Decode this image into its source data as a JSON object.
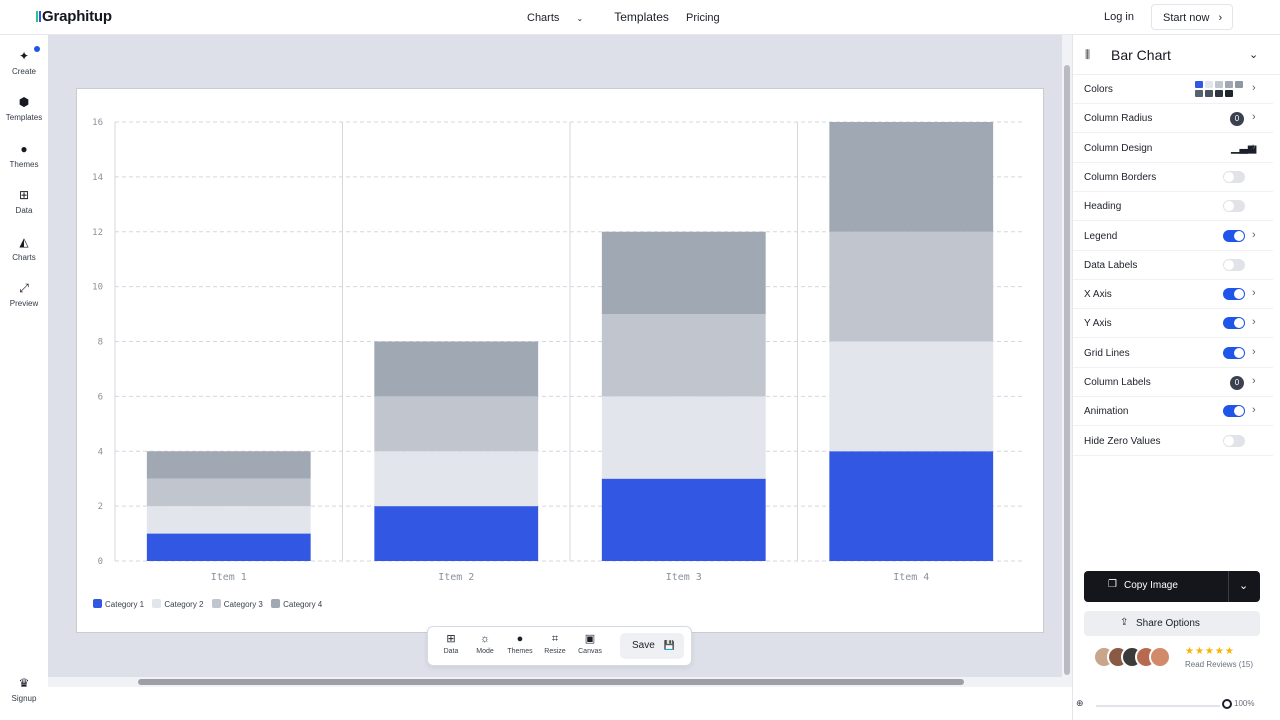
{
  "header": {
    "logo": "Graphitup",
    "nav": [
      "Charts",
      "Templates",
      "Pricing"
    ],
    "nav_charts_chevron": "⌄",
    "login": "Log in",
    "start": "Start now",
    "start_chevron": "›"
  },
  "rail": {
    "items": [
      {
        "label": "Create",
        "icon": "sparkle-icon",
        "glyph": "✦"
      },
      {
        "label": "Templates",
        "icon": "cube-icon",
        "glyph": "⬢"
      },
      {
        "label": "Themes",
        "icon": "theme-icon",
        "glyph": "●"
      },
      {
        "label": "Data",
        "icon": "table-icon",
        "glyph": "⊞"
      },
      {
        "label": "Charts",
        "icon": "area-chart-icon",
        "glyph": "◭"
      },
      {
        "label": "Preview",
        "icon": "expand-icon",
        "glyph": "⤢"
      }
    ],
    "signup": {
      "label": "Signup",
      "glyph": "♛"
    }
  },
  "chart_data": {
    "type": "bar",
    "stacked": true,
    "categories": [
      "Item 1",
      "Item 2",
      "Item 3",
      "Item 4"
    ],
    "series": [
      {
        "name": "Category 1",
        "color": "#3157e3",
        "values": [
          1,
          2,
          3,
          4
        ]
      },
      {
        "name": "Category 2",
        "color": "#e3e5ec",
        "values": [
          1,
          2,
          3,
          4
        ]
      },
      {
        "name": "Category 3",
        "color": "#c0c5ce",
        "values": [
          1,
          2,
          3,
          4
        ]
      },
      {
        "name": "Category 4",
        "color": "#a0a8b3",
        "values": [
          1,
          2,
          3,
          4
        ]
      }
    ],
    "yticks": [
      0,
      2,
      4,
      6,
      8,
      10,
      12,
      14,
      16
    ],
    "ylim": [
      0,
      16
    ],
    "grid": true,
    "legend": "bottom-left",
    "title": "",
    "xlabel": "",
    "ylabel": ""
  },
  "toolbar": {
    "items": [
      {
        "label": "Data",
        "glyph": "⊞"
      },
      {
        "label": "Mode",
        "glyph": "☼"
      },
      {
        "label": "Themes",
        "glyph": "●"
      },
      {
        "label": "Resize",
        "glyph": "⌗"
      },
      {
        "label": "Canvas",
        "glyph": "▣"
      }
    ],
    "save": "Save",
    "save_glyph": "💾"
  },
  "panel": {
    "title": "Bar Chart",
    "title_glyph": "⫼",
    "title_chevron": "⌄",
    "rows": [
      {
        "label": "Colors",
        "control": "swatches",
        "chevron": true
      },
      {
        "label": "Column Radius",
        "control": "badge",
        "value": "0",
        "chevron": true
      },
      {
        "label": "Column Design",
        "control": "design",
        "chevron": true
      },
      {
        "label": "Column Borders",
        "control": "toggle",
        "on": false,
        "chevron": false
      },
      {
        "label": "Heading",
        "control": "toggle",
        "on": false,
        "chevron": false
      },
      {
        "label": "Legend",
        "control": "toggle",
        "on": true,
        "chevron": true
      },
      {
        "label": "Data Labels",
        "control": "toggle",
        "on": false,
        "chevron": false
      },
      {
        "label": "X Axis",
        "control": "toggle",
        "on": true,
        "chevron": true
      },
      {
        "label": "Y Axis",
        "control": "toggle",
        "on": true,
        "chevron": true
      },
      {
        "label": "Grid Lines",
        "control": "toggle",
        "on": true,
        "chevron": true
      },
      {
        "label": "Column Labels",
        "control": "badge",
        "value": "0",
        "chevron": true
      },
      {
        "label": "Animation",
        "control": "toggle",
        "on": true,
        "chevron": true
      },
      {
        "label": "Hide Zero Values",
        "control": "toggle",
        "on": false,
        "chevron": false
      }
    ],
    "swatch_colors": [
      "#3157e3",
      "#e3e5ec",
      "#c0c5ce",
      "#a0a8b3",
      "#8f97a3",
      "#56606e",
      "#4a5260",
      "#2f3540",
      "#1f242c"
    ],
    "design_glyph": "▁▃▅",
    "row_chevron": "›",
    "copy": "Copy Image",
    "copy_glyph": "❐",
    "copy_chevron": "⌄",
    "share": "Share Options",
    "share_glyph": "⇪",
    "stars": "★★★★★",
    "reviews": "Read Reviews (15)",
    "avatar_colors": [
      "#c9a58c",
      "#8a5a44",
      "#3b3b3b",
      "#b86a50",
      "#d18a6a"
    ]
  },
  "zoom": {
    "plus": "⊕",
    "value": "100%"
  }
}
